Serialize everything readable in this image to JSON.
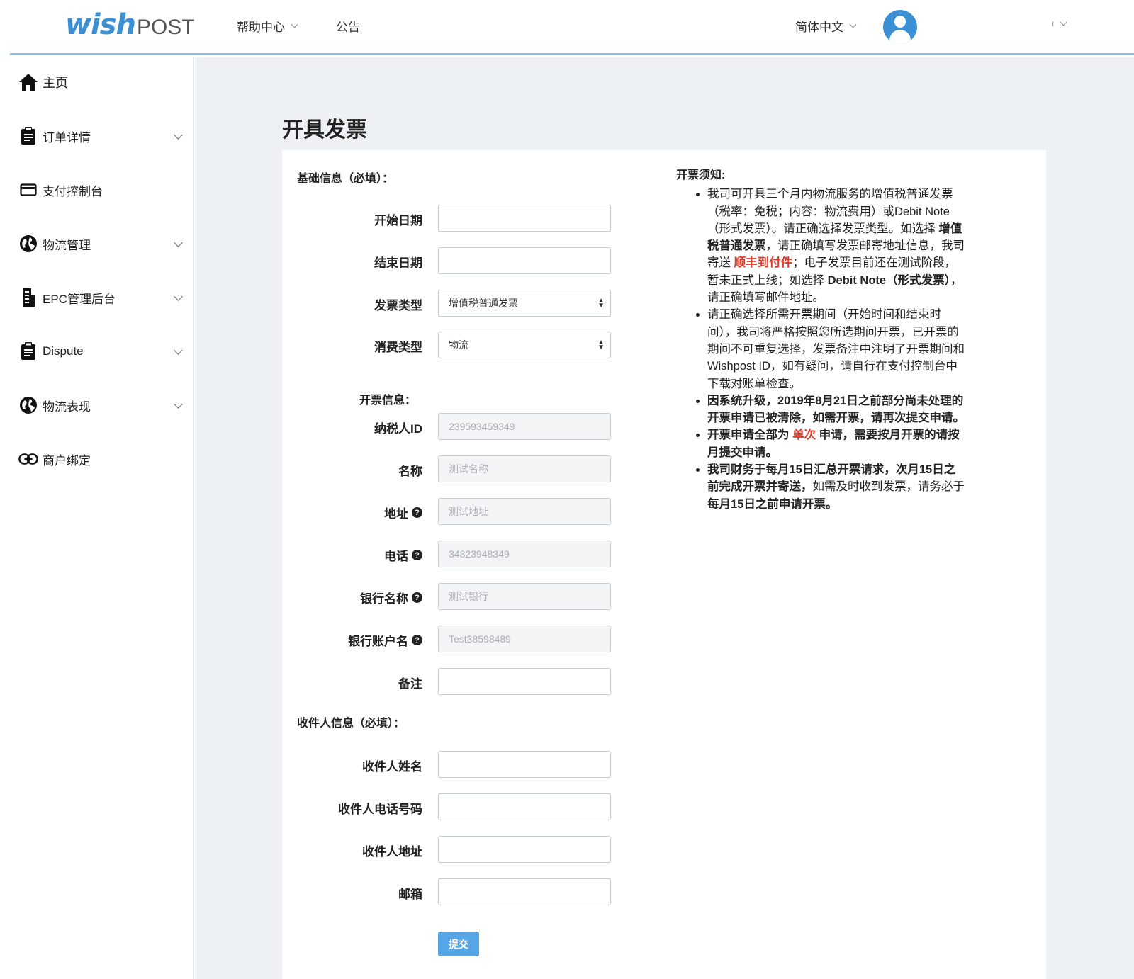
{
  "header": {
    "logo_wish": "wish",
    "logo_post": "POST",
    "help_center": "帮助中心",
    "announcement": "公告",
    "language": "简体中文",
    "user_menu_text": "ı"
  },
  "sidebar": {
    "items": [
      {
        "label": "主页",
        "icon": "home-icon"
      },
      {
        "label": "订单详情",
        "icon": "clipboard-icon"
      },
      {
        "label": "支付控制台",
        "icon": "credit-card-icon"
      },
      {
        "label": "物流管理",
        "icon": "globe-icon"
      },
      {
        "label": "EPC管理后台",
        "icon": "building-icon"
      },
      {
        "label": "Dispute",
        "icon": "clipboard-icon"
      },
      {
        "label": "物流表现",
        "icon": "globe-icon"
      },
      {
        "label": "商户绑定",
        "icon": "link-icon"
      }
    ]
  },
  "page": {
    "title": "开具发票"
  },
  "form": {
    "basic_section": "基础信息（必填）：",
    "start_date_label": "开始日期",
    "start_date_value": "",
    "end_date_label": "结束日期",
    "end_date_value": "",
    "invoice_type_label": "发票类型",
    "invoice_type_value": "增值税普通发票",
    "consume_type_label": "消费类型",
    "consume_type_value": "物流",
    "invoice_info_section": "开票信息：",
    "taxpayer_id_label": "纳税人ID",
    "taxpayer_id_value": "239593459349",
    "name_label": "名称",
    "name_value": "测试名称",
    "address_label": "地址",
    "address_value": "测试地址",
    "phone_label": "电话",
    "phone_value": "34823948349",
    "bank_name_label": "银行名称",
    "bank_name_value": "测试银行",
    "bank_account_label": "银行账户名",
    "bank_account_value": "Test38598489",
    "remark_label": "备注",
    "remark_value": "",
    "recipient_section": "收件人信息（必填）：",
    "recipient_name_label": "收件人姓名",
    "recipient_name_value": "",
    "recipient_phone_label": "收件人电话号码",
    "recipient_phone_value": "",
    "recipient_address_label": "收件人地址",
    "recipient_address_value": "",
    "email_label": "邮箱",
    "email_value": "",
    "submit_label": "提交",
    "help_icon_glyph": "?"
  },
  "notice": {
    "title": "开票须知:",
    "item1_a": "我司可开具三个月内物流服务的增值税普通发票（税率：免税；内容：物流费用）或Debit Note（形式发票）。请正确选择发票类型。如选择 ",
    "item1_b": "增值税普通发票",
    "item1_c": "，请正确填写发票邮寄地址信息，我司寄送 ",
    "item1_d": "顺丰到付件",
    "item1_e": "；电子发票目前还在测试阶段，暂未正式上线；如选择 ",
    "item1_f": "Debit Note（形式发票）",
    "item1_g": "，请正确填写邮件地址。",
    "item2": "请正确选择所需开票期间（开始时间和结束时间），我司将严格按照您所选期间开票，已开票的期间不可重复选择，发票备注中注明了开票期间和Wishpost ID，如有疑问，请自行在支付控制台中下载对账单检查。",
    "item3": "因系统升级，2019年8月21日之前部分尚未处理的开票申请已被清除，如需开票，请再次提交申请。",
    "item4_a": "开票申请全部为 ",
    "item4_b": "单次",
    "item4_c": " 申请，需要按月开票的请按月提交申请。",
    "item5_a": "我司财务于每月15日汇总开票请求，次月15日之前完成开票并寄送，",
    "item5_b": "如需及时收到发票，请务必于 ",
    "item5_c": "每月15日之前申请开票。"
  },
  "colors": {
    "brand_blue": "#3d8fd4",
    "submit_blue": "#56a6e6",
    "highlight_red": "#e03a2b",
    "main_bg": "#eef1f4"
  }
}
